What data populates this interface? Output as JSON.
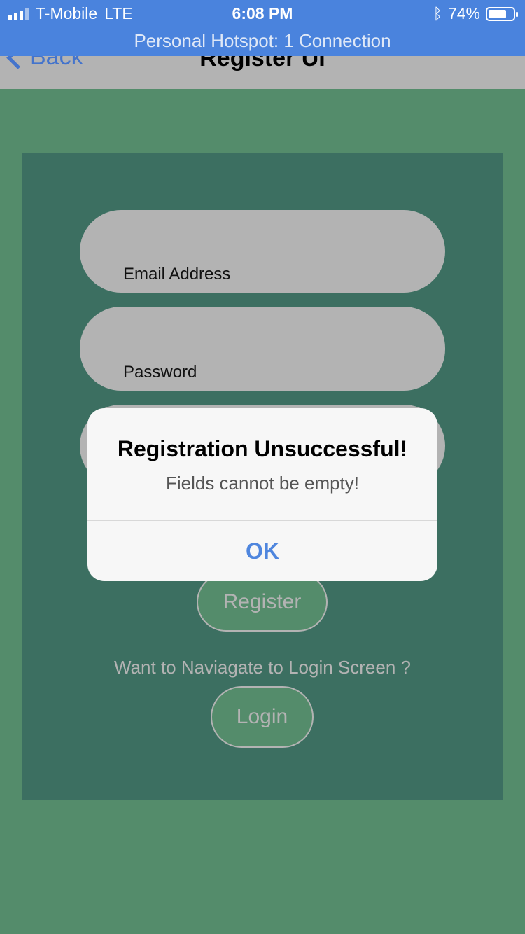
{
  "status_bar": {
    "carrier": "T-Mobile",
    "network": "LTE",
    "time": "6:08 PM",
    "battery_percent": "74%",
    "battery_level": 0.74,
    "hotspot": "Personal Hotspot: 1 Connection",
    "icons": [
      "signal-icon",
      "bluetooth-icon",
      "battery-icon"
    ]
  },
  "nav": {
    "back_label": "Back",
    "title": "Register UI"
  },
  "form": {
    "email_label": "Email Address",
    "password_label": "Password",
    "register_label": "Register",
    "navigate_prompt": "Want to Naviagate to Login Screen ?",
    "login_label": "Login"
  },
  "alert": {
    "title": "Registration Unsuccessful!",
    "message": "Fields cannot be empty!",
    "ok_label": "OK"
  },
  "colors": {
    "background": "#548c6b",
    "panel": "#3c6f61",
    "field": "#b3b3b3",
    "statusbar": "#4a83dd",
    "alert_button": "#4f86de"
  }
}
